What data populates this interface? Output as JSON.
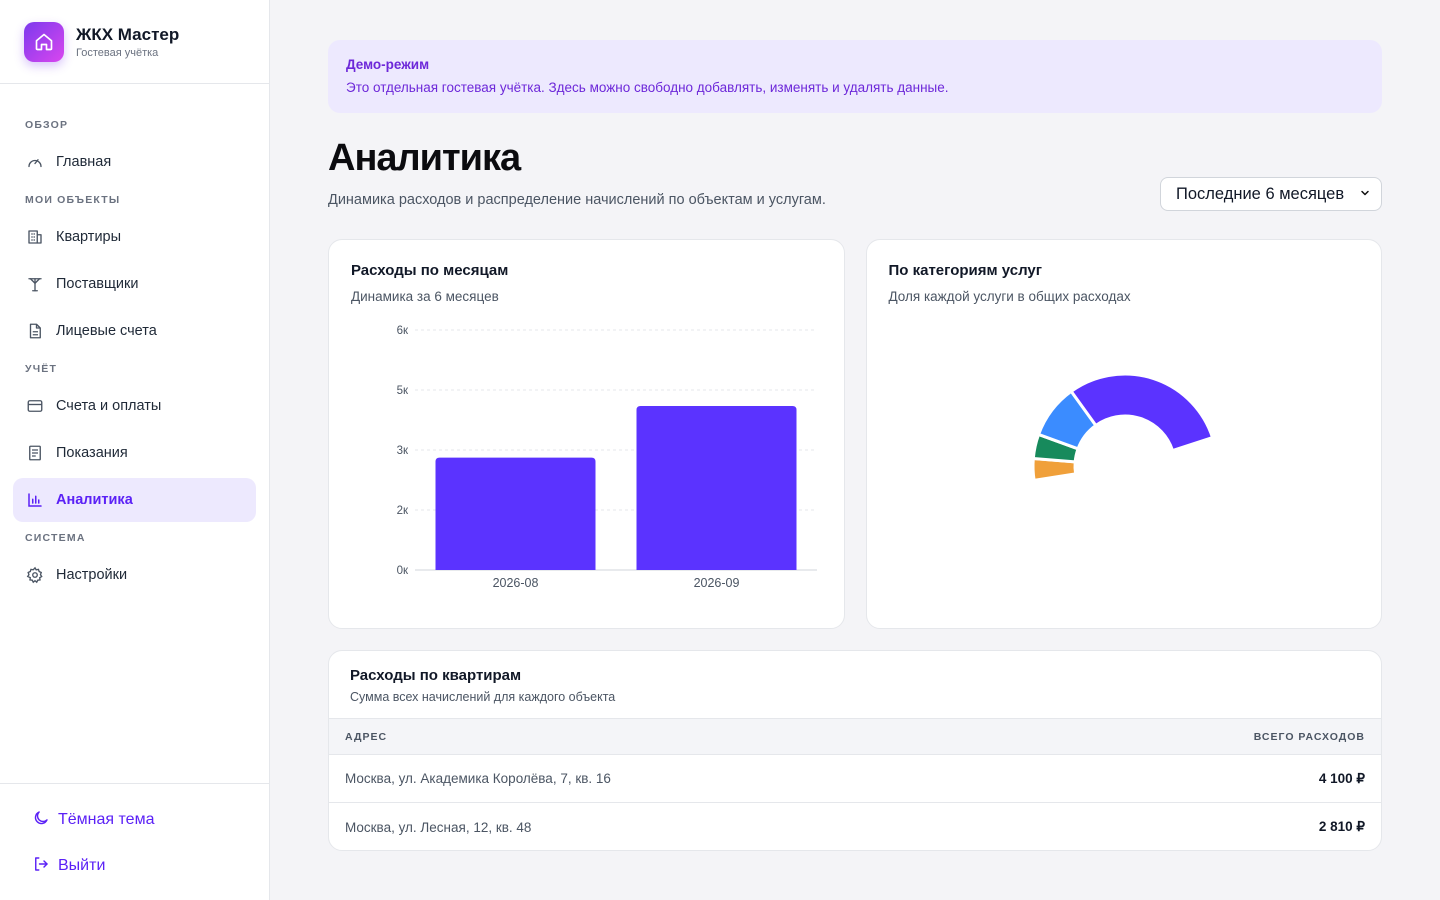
{
  "brand": {
    "title": "ЖКХ Мастер",
    "subtitle": "Гостевая учётка",
    "icon": "home-icon"
  },
  "sidebar": {
    "sections": [
      {
        "label": "ОБЗОР"
      },
      {
        "label": "МОИ ОБЪЕКТЫ"
      },
      {
        "label": "УЧЁТ"
      },
      {
        "label": "СИСТЕМА"
      }
    ],
    "items": [
      {
        "label": "Главная",
        "icon": "gauge-icon"
      },
      {
        "label": "Квартиры",
        "icon": "building-icon"
      },
      {
        "label": "Поставщики",
        "icon": "tower-icon"
      },
      {
        "label": "Лицевые счета",
        "icon": "document-icon"
      },
      {
        "label": "Счета и оплаты",
        "icon": "credit-card-icon"
      },
      {
        "label": "Показания",
        "icon": "list-document-icon"
      },
      {
        "label": "Аналитика",
        "icon": "bar-chart-icon",
        "active": true
      },
      {
        "label": "Настройки",
        "icon": "gear-icon"
      }
    ],
    "bottom": [
      {
        "label": "Тёмная тема",
        "icon": "moon-icon"
      },
      {
        "label": "Выйти",
        "icon": "logout-icon"
      }
    ]
  },
  "banner": {
    "title": "Демо-режим",
    "text": "Это отдельная гостевая учётка. Здесь можно свободно добавлять, изменять и удалять данные."
  },
  "page": {
    "title": "Аналитика",
    "subtitle": "Динамика расходов и распределение начислений по объектам и услугам.",
    "period": "Последние 6 месяцев"
  },
  "monthly_card": {
    "title": "Расходы по месяцам",
    "subtitle": "Динамика за 6 месяцев"
  },
  "category_card": {
    "title": "По категориям услуг",
    "subtitle": "Доля каждой услуги в общих расходах"
  },
  "apartments_card": {
    "title": "Расходы по квартирам",
    "subtitle": "Сумма всех начислений для каждого объекта",
    "columns": [
      "АДРЕС",
      "ВСЕГО РАСХОДОВ"
    ],
    "rows": [
      {
        "address": "Москва, ул. Академика Королёва, 7, кв. 16",
        "total": "4 100 ₽"
      },
      {
        "address": "Москва, ул. Лесная, 12, кв. 48",
        "total": "2 810 ₽"
      }
    ]
  },
  "colors": {
    "accent": "#5b33ff",
    "orange": "#f0a03a",
    "green": "#178a5c",
    "blue": "#3b8cff"
  },
  "chart_data": [
    {
      "type": "bar",
      "categories": [
        "2026-08",
        "2026-09"
      ],
      "values": [
        2810,
        4100
      ],
      "ytick_labels": [
        "0к",
        "2к",
        "3к",
        "5к",
        "6к"
      ],
      "ytick_values": [
        0,
        1500,
        3000,
        4500,
        6000
      ],
      "ylim": [
        0,
        6000
      ],
      "grid": true
    },
    {
      "type": "pie",
      "variant": "half-donut",
      "slices": [
        {
          "share": 0.08,
          "color": "#f0a03a"
        },
        {
          "share": 0.09,
          "color": "#178a5c"
        },
        {
          "share": 0.2,
          "color": "#3b8cff"
        },
        {
          "share": 0.63,
          "color": "#5b33ff"
        }
      ]
    }
  ]
}
